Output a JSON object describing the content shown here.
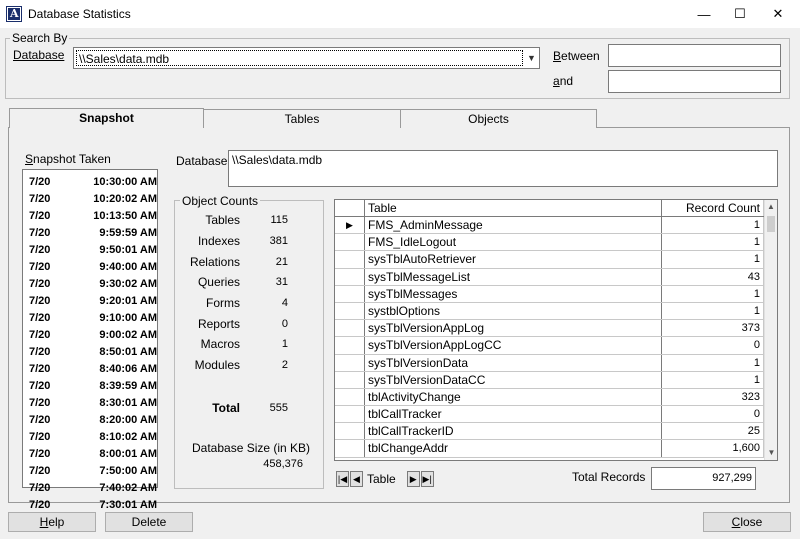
{
  "window": {
    "title": "Database Statistics",
    "minimize_glyph": "—",
    "maximize_glyph": "☐",
    "close_glyph": "✕"
  },
  "search": {
    "group_label": "Search By",
    "database_label": "Database",
    "database_value": "\\\\Sales\\data.mdb",
    "between_label": "Between",
    "and_label": "and",
    "between_value": "",
    "and_value": ""
  },
  "tabs": [
    "Snapshot",
    "Tables",
    "Objects"
  ],
  "snapshot": {
    "label": "Snapshot Taken",
    "items": [
      {
        "date": "7/20",
        "time": "10:30:00 AM"
      },
      {
        "date": "7/20",
        "time": "10:20:02 AM"
      },
      {
        "date": "7/20",
        "time": "10:13:50 AM"
      },
      {
        "date": "7/20",
        "time": "9:59:59 AM"
      },
      {
        "date": "7/20",
        "time": "9:50:01 AM"
      },
      {
        "date": "7/20",
        "time": "9:40:00 AM"
      },
      {
        "date": "7/20",
        "time": "9:30:02 AM"
      },
      {
        "date": "7/20",
        "time": "9:20:01 AM"
      },
      {
        "date": "7/20",
        "time": "9:10:00 AM"
      },
      {
        "date": "7/20",
        "time": "9:00:02 AM"
      },
      {
        "date": "7/20",
        "time": "8:50:01 AM"
      },
      {
        "date": "7/20",
        "time": "8:40:06 AM"
      },
      {
        "date": "7/20",
        "time": "8:39:59 AM"
      },
      {
        "date": "7/20",
        "time": "8:30:01 AM"
      },
      {
        "date": "7/20",
        "time": "8:20:00 AM"
      },
      {
        "date": "7/20",
        "time": "8:10:02 AM"
      },
      {
        "date": "7/20",
        "time": "8:00:01 AM"
      },
      {
        "date": "7/20",
        "time": "7:50:00 AM"
      },
      {
        "date": "7/20",
        "time": "7:40:02 AM"
      },
      {
        "date": "7/20",
        "time": "7:30:01 AM"
      }
    ]
  },
  "detail": {
    "database_label": "Database",
    "database_value": "\\\\Sales\\data.mdb"
  },
  "object_counts": {
    "label": "Object Counts",
    "items": [
      {
        "label": "Tables",
        "value": "115"
      },
      {
        "label": "Indexes",
        "value": "381"
      },
      {
        "label": "Relations",
        "value": "21"
      },
      {
        "label": "Queries",
        "value": "31"
      },
      {
        "label": "Forms",
        "value": "4"
      },
      {
        "label": "Reports",
        "value": "0"
      },
      {
        "label": "Macros",
        "value": "1"
      },
      {
        "label": "Modules",
        "value": "2"
      }
    ],
    "total_label": "Total",
    "total_value": "555",
    "size_label": "Database Size (in KB)",
    "size_value": "458,376"
  },
  "table_grid": {
    "col_table": "Table",
    "col_count": "Record Count",
    "current_row_glyph": "▶",
    "rows": [
      {
        "name": "FMS_AdminMessage",
        "count": "1"
      },
      {
        "name": "FMS_IdleLogout",
        "count": "1"
      },
      {
        "name": "sysTblAutoRetriever",
        "count": "1"
      },
      {
        "name": "sysTblMessageList",
        "count": "43"
      },
      {
        "name": "sysTblMessages",
        "count": "1"
      },
      {
        "name": "systblOptions",
        "count": "1"
      },
      {
        "name": "sysTblVersionAppLog",
        "count": "373"
      },
      {
        "name": "sysTblVersionAppLogCC",
        "count": "0"
      },
      {
        "name": "sysTblVersionData",
        "count": "1"
      },
      {
        "name": "sysTblVersionDataCC",
        "count": "1"
      },
      {
        "name": "tblActivityChange",
        "count": "323"
      },
      {
        "name": "tblCallTracker",
        "count": "0"
      },
      {
        "name": "tblCallTrackerID",
        "count": "25"
      },
      {
        "name": "tblChangeAddr",
        "count": "1,600"
      }
    ],
    "nav_label": "Table",
    "total_records_label": "Total Records",
    "total_records_value": "927,299"
  },
  "buttons": {
    "help": "Help",
    "delete": "Delete",
    "close": "Close"
  }
}
